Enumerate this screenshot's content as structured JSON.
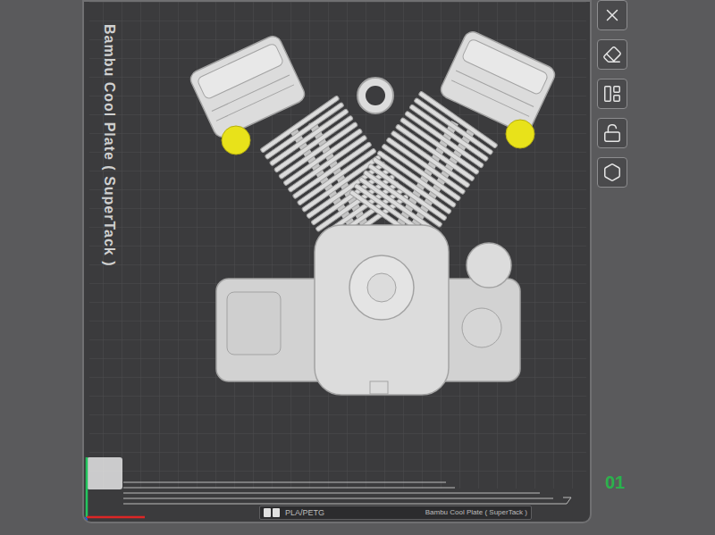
{
  "plate": {
    "name": "Bambu Cool Plate ( SuperTack )",
    "index": "01",
    "selected": true
  },
  "plate_label": {
    "filament": "PLA/PETG",
    "name": "Bambu Cool Plate ( SuperTack )"
  }
}
